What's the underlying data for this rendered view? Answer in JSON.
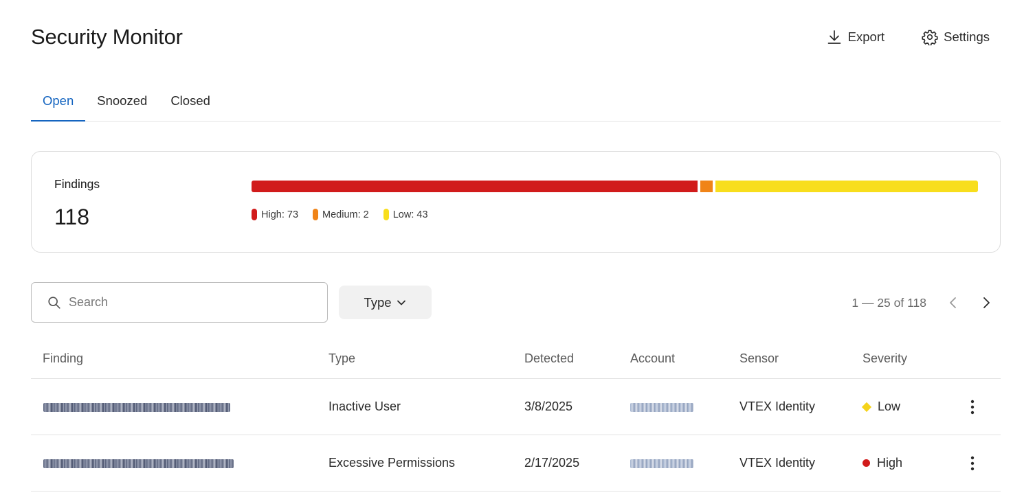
{
  "header": {
    "title": "Security Monitor",
    "export_label": "Export",
    "settings_label": "Settings"
  },
  "tabs": [
    {
      "label": "Open",
      "active": true
    },
    {
      "label": "Snoozed",
      "active": false
    },
    {
      "label": "Closed",
      "active": false
    }
  ],
  "findings": {
    "label": "Findings",
    "total": "118",
    "severity": [
      {
        "label": "High: 73",
        "count": 73,
        "color": "#d11b1b"
      },
      {
        "label": "Medium: 2",
        "count": 2,
        "color": "#f08418"
      },
      {
        "label": "Low: 43",
        "count": 43,
        "color": "#f8de1d"
      }
    ]
  },
  "toolbar": {
    "search_placeholder": "Search",
    "type_label": "Type",
    "pagination_text": "1 — 25 of 118"
  },
  "table": {
    "columns": [
      "Finding",
      "Type",
      "Detected",
      "Account",
      "Sensor",
      "Severity"
    ],
    "rows": [
      {
        "type": "Inactive User",
        "detected": "3/8/2025",
        "sensor": "VTEX Identity",
        "severity": "Low",
        "severity_color": "#f5d31b",
        "severity_icon": "diamond-icon"
      },
      {
        "type": "Excessive Permissions",
        "detected": "2/17/2025",
        "sensor": "VTEX Identity",
        "severity": "High",
        "severity_color": "#d11b1b",
        "severity_icon": "dot-icon"
      }
    ]
  },
  "colors": {
    "accent": "#1565c0",
    "high": "#d11b1b",
    "medium": "#f08418",
    "low": "#f8de1d"
  }
}
